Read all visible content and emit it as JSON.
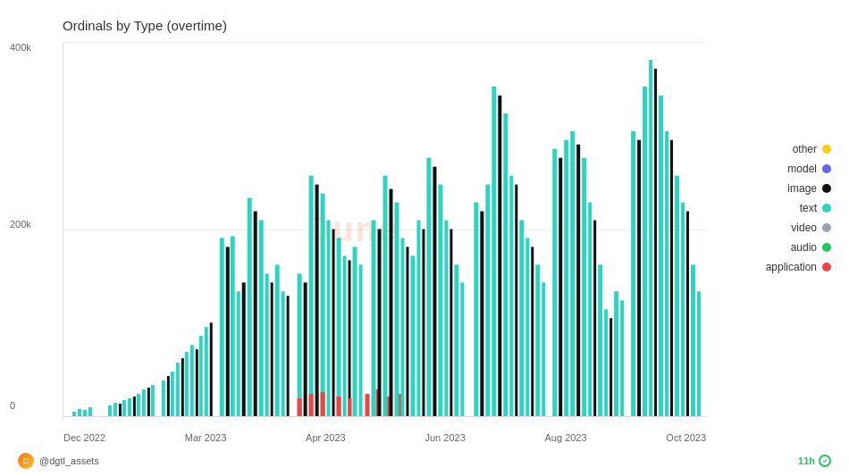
{
  "title": "Ordinals by Type (overtime)",
  "yAxis": {
    "labels": [
      "400k",
      "200k",
      "0"
    ],
    "gridLines": [
      0,
      50,
      100
    ]
  },
  "xAxis": {
    "labels": [
      "Dec 2022",
      "Mar 2023",
      "Apr 2023",
      "Jun 2023",
      "Aug 2023",
      "Oct 2023"
    ]
  },
  "legend": {
    "items": [
      {
        "label": "other",
        "color": "#facc15"
      },
      {
        "label": "model",
        "color": "#6366f1"
      },
      {
        "label": "image",
        "color": "#111111"
      },
      {
        "label": "text",
        "color": "#2dd4bf"
      },
      {
        "label": "video",
        "color": "#9ca3af"
      },
      {
        "label": "audio",
        "color": "#22c55e"
      },
      {
        "label": "application",
        "color": "#ef4444"
      }
    ]
  },
  "footer": {
    "username": "@dgtl_assets",
    "timeAgo": "11h",
    "watermark": "Dune"
  },
  "colors": {
    "text": "#2dd4bf",
    "image": "#111111",
    "application": "#ef4444",
    "audio": "#22c55e",
    "other": "#facc15",
    "model": "#6366f1",
    "video": "#9ca3af"
  }
}
